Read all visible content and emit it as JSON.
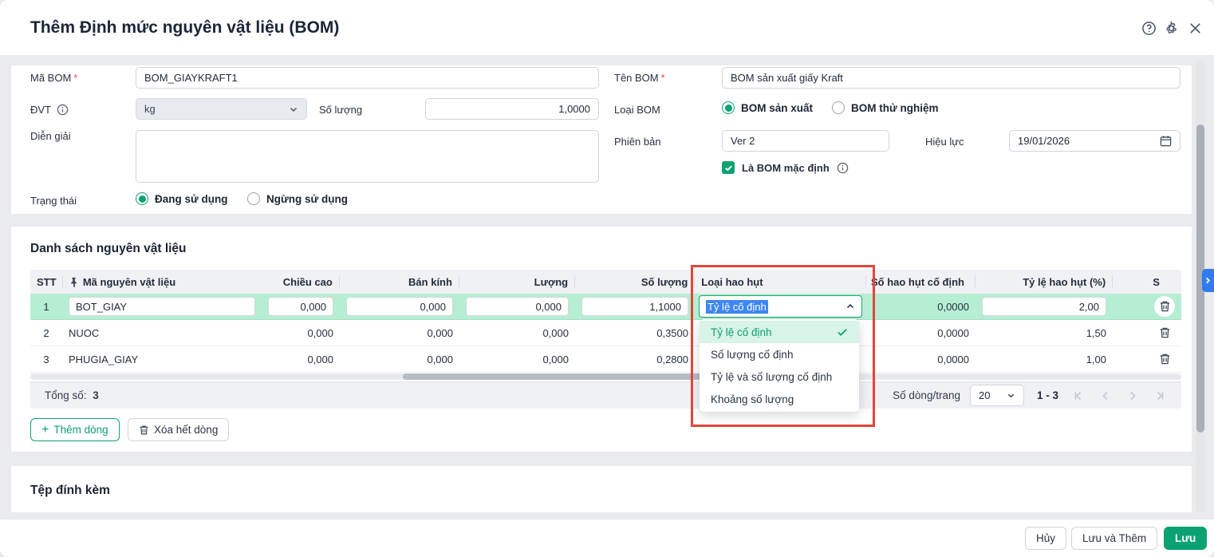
{
  "header": {
    "title": "Thêm Định mức nguyên vật liệu (BOM)"
  },
  "icons": {
    "help": "?",
    "gear": "settings",
    "close": "✕",
    "plus": "+",
    "pin": "pushpin",
    "calendar": "calendar",
    "trash": "trash",
    "check": "✓"
  },
  "form": {
    "ma_bom": {
      "label": "Mã BOM",
      "value": "BOM_GIAYKRAFT1"
    },
    "ten_bom": {
      "label": "Tên BOM",
      "value": "BOM sản xuất giấy Kraft"
    },
    "dvt": {
      "label": "ĐVT",
      "value": "kg"
    },
    "so_luong": {
      "label": "Số lượng",
      "value": "1,0000"
    },
    "loai_bom": {
      "label": "Loại BOM",
      "option1": "BOM sản xuất",
      "option2": "BOM thử nghiệm",
      "selected": "BOM sản xuất"
    },
    "dien_giai": {
      "label": "Diễn giải",
      "value": ""
    },
    "phien_ban": {
      "label": "Phiên bản",
      "value": "Ver 2"
    },
    "hieu_luc": {
      "label": "Hiệu lực",
      "value": "19/01/2026"
    },
    "la_bom_mac_dinh": {
      "label": "Là BOM mặc định",
      "checked": true
    },
    "trang_thai": {
      "label": "Trạng thái",
      "option1": "Đang sử dụng",
      "option2": "Ngừng sử dụng",
      "selected": "Đang sử dụng"
    }
  },
  "materials": {
    "section_title": "Danh sách nguyên vật liệu",
    "columns": {
      "stt": "STT",
      "code": "Mã nguyên vật liệu",
      "chieu_cao": "Chiều cao",
      "ban_kinh": "Bán kính",
      "luong": "Lượng",
      "so_luong": "Số lượng",
      "loai_hao_hut": "Loại hao hụt",
      "so_hao_hut": "Số hao hụt cố định",
      "ty_le": "Tỷ lệ hao hụt (%)",
      "clipped": "S"
    },
    "rows": [
      {
        "stt": "1",
        "code": "BOT_GIAY",
        "chieu_cao": "0,000",
        "ban_kinh": "0,000",
        "luong": "0,000",
        "so_luong": "1,1000",
        "loai_hao_hut": "Tỷ lệ cố định",
        "so_hao_hut": "0,0000",
        "ty_le": "2,00"
      },
      {
        "stt": "2",
        "code": "NUOC",
        "chieu_cao": "0,000",
        "ban_kinh": "0,000",
        "luong": "0,000",
        "so_luong": "0,3500",
        "loai_hao_hut": "",
        "so_hao_hut": "0,0000",
        "ty_le": "1,50"
      },
      {
        "stt": "3",
        "code": "PHUGIA_GIAY",
        "chieu_cao": "0,000",
        "ban_kinh": "0,000",
        "luong": "0,000",
        "so_luong": "0,2800",
        "loai_hao_hut": "",
        "so_hao_hut": "0,0000",
        "ty_le": "1,00"
      }
    ],
    "dropdown": {
      "selected": "Tỷ lệ cố định",
      "options": [
        "Tỷ lệ cố định",
        "Số lượng cố định",
        "Tỷ lệ và số lượng cố định",
        "Khoảng số lượng"
      ]
    },
    "footer": {
      "total_label": "Tổng số:",
      "total": "3",
      "per_page_label": "Số dòng/trang",
      "per_page": "20",
      "range": "1 - 3"
    },
    "actions": {
      "add_row": "Thêm dòng",
      "delete_all": "Xóa hết dòng"
    }
  },
  "attachments": {
    "section_title": "Tệp đính kèm"
  },
  "footer_buttons": {
    "cancel": "Hủy",
    "save_and_add": "Lưu và Thêm",
    "save": "Lưu"
  },
  "colors": {
    "accent_green": "#0da26f",
    "row_highlight": "#b6eed3",
    "annotation_red": "#e2453a",
    "tab_blue": "#2e7cf0"
  }
}
